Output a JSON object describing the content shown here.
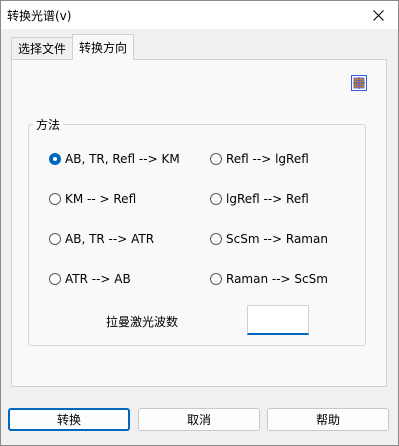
{
  "window": {
    "title": "转换光谱(v)"
  },
  "tabs": [
    {
      "label": "选择文件"
    },
    {
      "label": "转换方向"
    }
  ],
  "group": {
    "title": "方法",
    "options": [
      {
        "label": "AB, TR, Refl --> KM",
        "checked": true
      },
      {
        "label": "Refl --> lgRefl",
        "checked": false
      },
      {
        "label": "KM -- > Refl",
        "checked": false
      },
      {
        "label": "lgRefl --> Refl",
        "checked": false
      },
      {
        "label": "AB, TR --> ATR",
        "checked": false
      },
      {
        "label": "ScSm --> Raman",
        "checked": false
      },
      {
        "label": "ATR --> AB",
        "checked": false
      },
      {
        "label": "Raman --> ScSm",
        "checked": false
      }
    ],
    "laser_label": "拉曼激光波数",
    "laser_value": ""
  },
  "buttons": {
    "convert": "转换",
    "cancel": "取消",
    "help": "帮助"
  },
  "colors": {
    "accent": "#0067c0"
  }
}
